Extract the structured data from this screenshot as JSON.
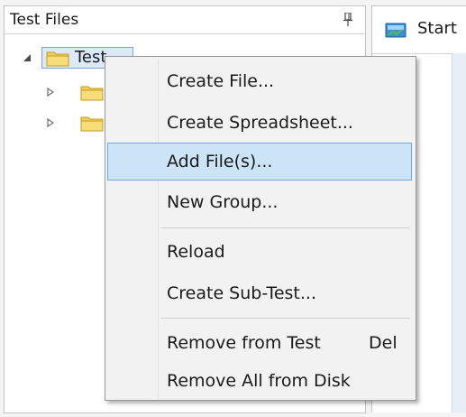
{
  "panel": {
    "title": "Test Files",
    "pin_icon": "pin-icon"
  },
  "tree": {
    "root": {
      "label": "Test",
      "icon": "folder-icon",
      "expanded": true
    },
    "children": [
      {
        "icon": "folder-icon",
        "expanded": false
      },
      {
        "icon": "folder-icon",
        "expanded": false
      }
    ]
  },
  "right_panel": {
    "tab_label": "Start",
    "tab_icon": "start-page-icon"
  },
  "context_menu": {
    "items": [
      {
        "label": "Create File...",
        "shortcut": ""
      },
      {
        "label": "Create Spreadsheet...",
        "shortcut": ""
      },
      {
        "label": "Add File(s)...",
        "shortcut": "",
        "highlighted": true
      },
      {
        "label": "New Group...",
        "shortcut": ""
      },
      {
        "label": "Reload",
        "shortcut": ""
      },
      {
        "label": "Create Sub-Test...",
        "shortcut": ""
      },
      {
        "label": "Remove from Test",
        "shortcut": "Del"
      },
      {
        "label": "Remove All from Disk",
        "shortcut": ""
      }
    ]
  },
  "colors": {
    "menu_background": "#f2f2f2",
    "menu_highlight": "#cce4f7",
    "menu_highlight_border": "#6fa8dc",
    "folder": "#f5c842"
  }
}
